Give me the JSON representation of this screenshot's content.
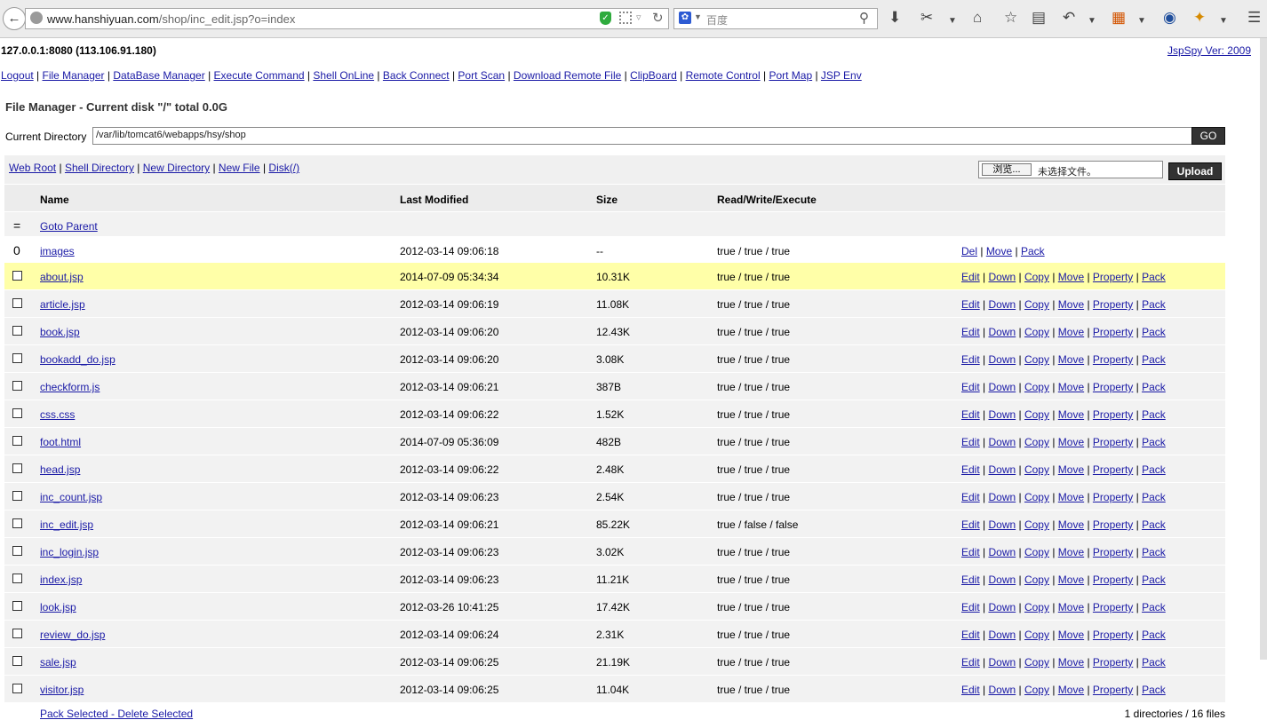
{
  "browser": {
    "url_domain": "www.hanshiyuan.com",
    "url_path": "/shop/inc_edit.jsp?o=index",
    "search_placeholder": "百度"
  },
  "header": {
    "host": "127.0.0.1:8080 (113.106.91.180)",
    "version_link": "JspSpy Ver: 2009"
  },
  "menu": [
    "Logout",
    "File Manager",
    "DataBase Manager",
    "Execute Command",
    "Shell OnLine",
    "Back Connect",
    "Port Scan",
    "Download Remote File",
    "ClipBoard",
    "Remote Control",
    "Port Map",
    "JSP Env"
  ],
  "file_manager": {
    "title": "File Manager - Current disk \"/\" total 0.0G",
    "current_dir_label": "Current Directory",
    "current_dir_value": "/var/lib/tomcat6/webapps/hsy/shop",
    "go_label": "GO",
    "action_links": [
      "Web Root",
      "Shell Directory",
      "New Directory",
      "New File",
      "Disk(/)"
    ],
    "browse_label": "浏览...",
    "no_file_label": "未选择文件。",
    "upload_label": "Upload",
    "columns": [
      "Name",
      "Last Modified",
      "Size",
      "Read/Write/Execute"
    ],
    "goto_parent_symbol": "=",
    "goto_parent": "Goto Parent",
    "dir_row": {
      "symbol": "0",
      "name": "images",
      "modified": "2012-03-14 09:06:18",
      "size": "--",
      "rwx": "true / true / true",
      "ops": [
        "Del",
        "Move",
        "Pack"
      ]
    },
    "file_ops": [
      "Edit",
      "Down",
      "Copy",
      "Move",
      "Property",
      "Pack"
    ],
    "files": [
      {
        "name": "about.jsp",
        "modified": "2014-07-09 05:34:34",
        "size": "10.31K",
        "rwx": "true / true / true"
      },
      {
        "name": "article.jsp",
        "modified": "2012-03-14 09:06:19",
        "size": "11.08K",
        "rwx": "true / true / true"
      },
      {
        "name": "book.jsp",
        "modified": "2012-03-14 09:06:20",
        "size": "12.43K",
        "rwx": "true / true / true"
      },
      {
        "name": "bookadd_do.jsp",
        "modified": "2012-03-14 09:06:20",
        "size": "3.08K",
        "rwx": "true / true / true"
      },
      {
        "name": "checkform.js",
        "modified": "2012-03-14 09:06:21",
        "size": "387B",
        "rwx": "true / true / true"
      },
      {
        "name": "css.css",
        "modified": "2012-03-14 09:06:22",
        "size": "1.52K",
        "rwx": "true / true / true"
      },
      {
        "name": "foot.html",
        "modified": "2014-07-09 05:36:09",
        "size": "482B",
        "rwx": "true / true / true"
      },
      {
        "name": "head.jsp",
        "modified": "2012-03-14 09:06:22",
        "size": "2.48K",
        "rwx": "true / true / true"
      },
      {
        "name": "inc_count.jsp",
        "modified": "2012-03-14 09:06:23",
        "size": "2.54K",
        "rwx": "true / true / true"
      },
      {
        "name": "inc_edit.jsp",
        "modified": "2012-03-14 09:06:21",
        "size": "85.22K",
        "rwx": "true / false / false"
      },
      {
        "name": "inc_login.jsp",
        "modified": "2012-03-14 09:06:23",
        "size": "3.02K",
        "rwx": "true / true / true"
      },
      {
        "name": "index.jsp",
        "modified": "2012-03-14 09:06:23",
        "size": "11.21K",
        "rwx": "true / true / true"
      },
      {
        "name": "look.jsp",
        "modified": "2012-03-26 10:41:25",
        "size": "17.42K",
        "rwx": "true / true / true"
      },
      {
        "name": "review_do.jsp",
        "modified": "2012-03-14 09:06:24",
        "size": "2.31K",
        "rwx": "true / true / true"
      },
      {
        "name": "sale.jsp",
        "modified": "2012-03-14 09:06:25",
        "size": "21.19K",
        "rwx": "true / true / true"
      },
      {
        "name": "visitor.jsp",
        "modified": "2012-03-14 09:06:25",
        "size": "11.04K",
        "rwx": "true / true / true"
      }
    ],
    "footer_left": "Pack Selected - Delete Selected",
    "footer_right": "1 directories / 16 files",
    "highlight_color": "#ffffa8"
  }
}
